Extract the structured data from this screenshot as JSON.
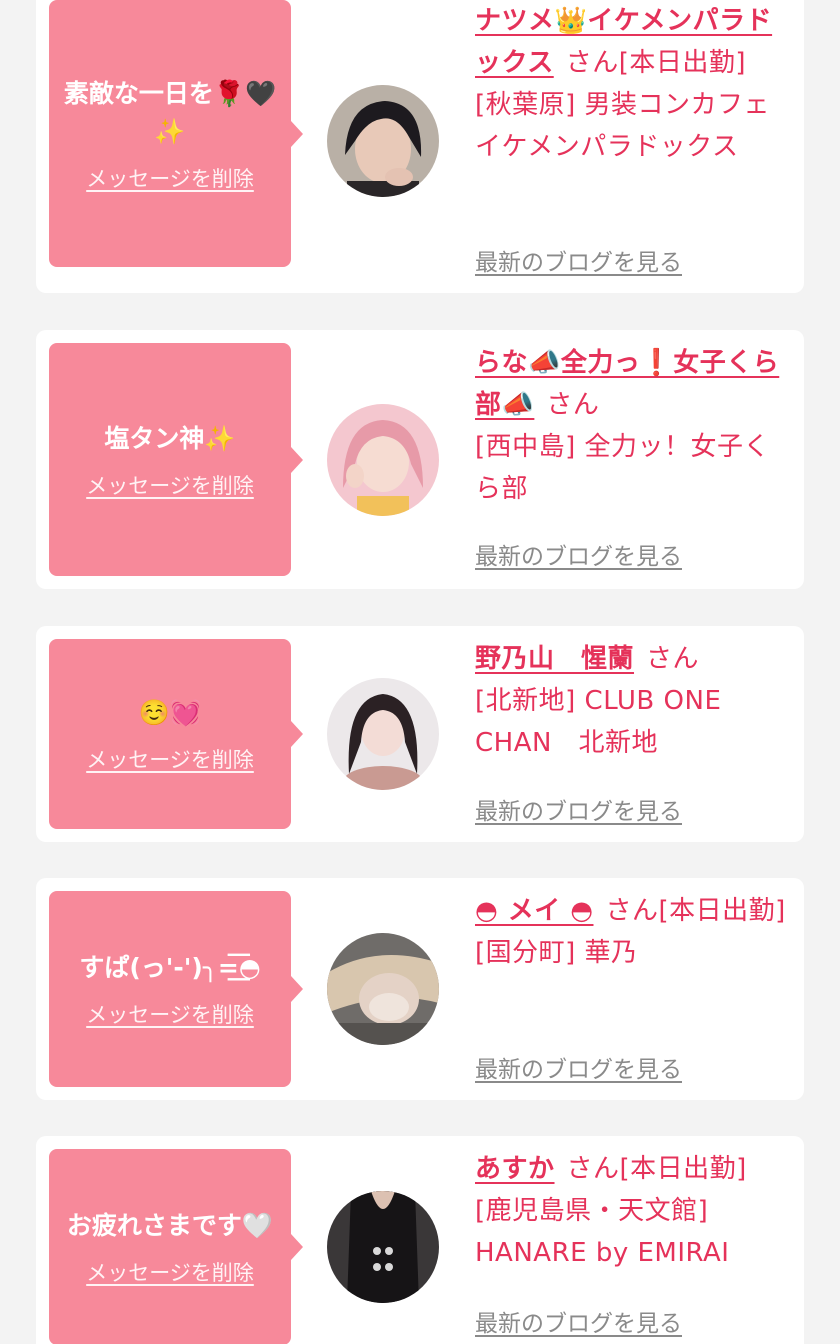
{
  "cards": [
    {
      "message": "素敵な一日を🌹🖤✨",
      "delete_label": "メッセージを削除",
      "name": "ナツメ👑イケメンパラドックス",
      "san": "さん",
      "status": "[本日出勤]",
      "location": "[秋葉原] 男装コンカフェイケメンパラドックス",
      "blog_label": "最新のブログを見る"
    },
    {
      "message": "塩タン神✨",
      "delete_label": "メッセージを削除",
      "name": "らな📣全力っ❗女子くら部📣",
      "san": "さん",
      "status": "",
      "location": "[西中島] 全力ッ！女子くら部",
      "blog_label": "最新のブログを見る"
    },
    {
      "message": "☺️💓",
      "delete_label": "メッセージを削除",
      "name": "野乃山　惺蘭",
      "san": "さん",
      "status": "",
      "location": "[北新地] CLUB ONE CHAN　北新地",
      "blog_label": "最新のブログを見る"
    },
    {
      "message": "すぱ(っ'-')╮=͟͟͞͞◓",
      "delete_label": "メッセージを削除",
      "name": "◓ メイ ◓",
      "san": "さん",
      "status": "[本日出勤]",
      "location": "[国分町] 華乃",
      "blog_label": "最新のブログを見る"
    },
    {
      "message": "お疲れさまです🤍",
      "delete_label": "メッセージを削除",
      "name": "あすか",
      "san": "さん",
      "status": "[本日出勤]",
      "location": "[鹿児島県・天文館] HANARE by EMIRAI",
      "blog_label": "最新のブログを見る"
    }
  ],
  "colors": {
    "bubble": "#f7899a",
    "accent_text": "#e5325a",
    "blog_link": "#8a8a8a",
    "background": "#f3f3f3"
  }
}
